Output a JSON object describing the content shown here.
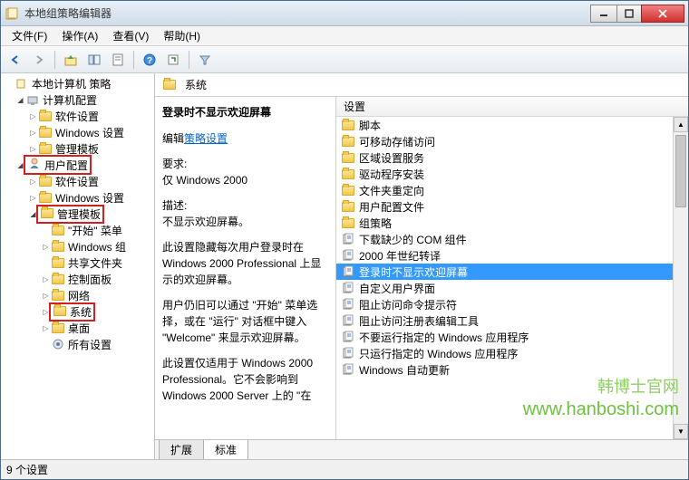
{
  "window": {
    "title": "本地组策略编辑器"
  },
  "menu": {
    "file": "文件(F)",
    "action": "操作(A)",
    "view": "查看(V)",
    "help": "帮助(H)"
  },
  "tree": {
    "root": "本地计算机 策略",
    "computer_config": "计算机配置",
    "software_settings": "软件设置",
    "windows_settings": "Windows 设置",
    "admin_templates": "管理模板",
    "user_config": "用户配置",
    "start_menu": "\"开始\" 菜单",
    "windows_components": "Windows 组",
    "shared_folders": "共享文件夹",
    "control_panel": "控制面板",
    "network": "网络",
    "system": "系统",
    "desktop": "桌面",
    "all_settings": "所有设置"
  },
  "right": {
    "header": "系统",
    "title": "登录时不显示欢迎屏幕",
    "edit_prefix": "编辑",
    "edit_link": "策略设置",
    "req_label": "要求:",
    "req_value": "仅 Windows 2000",
    "desc_label": "描述:",
    "desc_value": "不显示欢迎屏幕。",
    "desc_long1": "此设置隐藏每次用户登录时在 Windows 2000 Professional 上显示的欢迎屏幕。",
    "desc_long2": "用户仍旧可以通过 \"开始\" 菜单选择，或在 \"运行\" 对话框中键入 \"Welcome\" 来显示欢迎屏幕。",
    "desc_long3": "此设置仅适用于 Windows 2000 Professional。它不会影响到 Windows 2000 Server 上的 \"在",
    "col_setting": "设置"
  },
  "items": [
    {
      "type": "folder",
      "label": "脚本"
    },
    {
      "type": "folder",
      "label": "可移动存储访问"
    },
    {
      "type": "folder",
      "label": "区域设置服务"
    },
    {
      "type": "folder",
      "label": "驱动程序安装"
    },
    {
      "type": "folder",
      "label": "文件夹重定向"
    },
    {
      "type": "folder",
      "label": "用户配置文件"
    },
    {
      "type": "folder",
      "label": "组策略"
    },
    {
      "type": "setting",
      "label": "下载缺少的 COM 组件"
    },
    {
      "type": "setting",
      "label": "2000 年世纪转译"
    },
    {
      "type": "setting",
      "label": "登录时不显示欢迎屏幕",
      "selected": true
    },
    {
      "type": "setting",
      "label": "自定义用户界面"
    },
    {
      "type": "setting",
      "label": "阻止访问命令提示符"
    },
    {
      "type": "setting",
      "label": "阻止访问注册表编辑工具"
    },
    {
      "type": "setting",
      "label": "不要运行指定的 Windows 应用程序"
    },
    {
      "type": "setting",
      "label": "只运行指定的 Windows 应用程序"
    },
    {
      "type": "setting",
      "label": "Windows 自动更新"
    }
  ],
  "tabs": {
    "extended": "扩展",
    "standard": "标准"
  },
  "status": "9 个设置",
  "watermark": {
    "line1": "韩博士官网",
    "line2": "www.hanboshi.com"
  }
}
